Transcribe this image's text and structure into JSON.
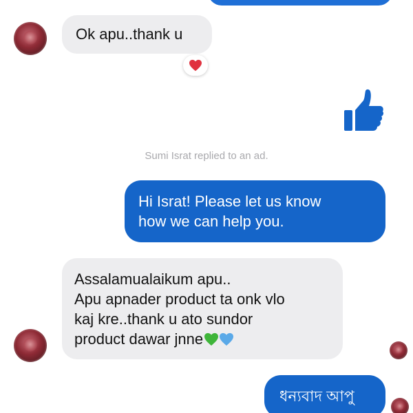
{
  "messages": {
    "incoming_1": {
      "text": "Ok apu..thank u",
      "reaction": "heart-icon"
    },
    "like": "thumbs-up-icon",
    "system_note": "Sumi Israt replied to an ad.",
    "outgoing_1": {
      "lines": [
        "Hi Israt! Please let us know",
        "how we can help you."
      ]
    },
    "incoming_2": {
      "lines": [
        "Assalamualaikum apu..",
        "Apu apnader product ta onk vlo",
        "kaj kre..thank u ato sundor",
        "product dawar jnne"
      ],
      "emoji": [
        "green-heart-icon",
        "blue-heart-icon"
      ]
    },
    "outgoing_2": {
      "text": "ধন্যবাদ আপু"
    }
  },
  "colors": {
    "outgoing_bubble": "#1565c9",
    "incoming_bubble": "#ededef",
    "like": "#1565c9",
    "heart_red": "#e0323f",
    "heart_green": "#3fb53a",
    "heart_blue": "#5aa9e8",
    "system_text": "#a8a8ac"
  }
}
